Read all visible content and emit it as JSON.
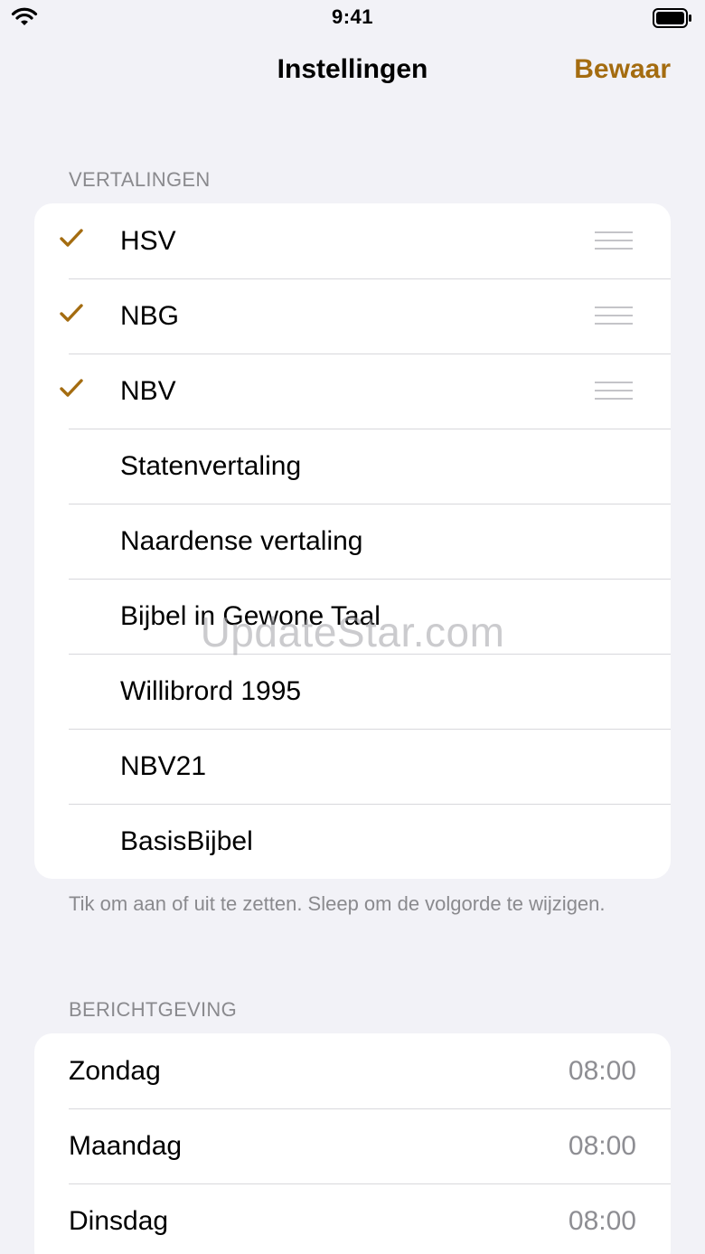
{
  "status_bar": {
    "time": "9:41"
  },
  "nav": {
    "title": "Instellingen",
    "save_label": "Bewaar"
  },
  "colors": {
    "accent": "#a46c10",
    "background": "#f2f2f7",
    "secondary_text": "#8a8a8e"
  },
  "translations": {
    "header": "VERTALINGEN",
    "items": [
      {
        "label": "HSV",
        "checked": true
      },
      {
        "label": "NBG",
        "checked": true
      },
      {
        "label": "NBV",
        "checked": true
      },
      {
        "label": "Statenvertaling",
        "checked": false
      },
      {
        "label": "Naardense vertaling",
        "checked": false
      },
      {
        "label": "Bijbel in Gewone Taal",
        "checked": false
      },
      {
        "label": "Willibrord 1995",
        "checked": false
      },
      {
        "label": "NBV21",
        "checked": false
      },
      {
        "label": "BasisBijbel",
        "checked": false
      }
    ],
    "footer": "Tik om aan of uit te zetten. Sleep om de volgorde te wijzigen."
  },
  "notifications": {
    "header": "BERICHTGEVING",
    "items": [
      {
        "day": "Zondag",
        "time": "08:00"
      },
      {
        "day": "Maandag",
        "time": "08:00"
      },
      {
        "day": "Dinsdag",
        "time": "08:00"
      }
    ]
  },
  "watermark": "UpdateStar.com"
}
